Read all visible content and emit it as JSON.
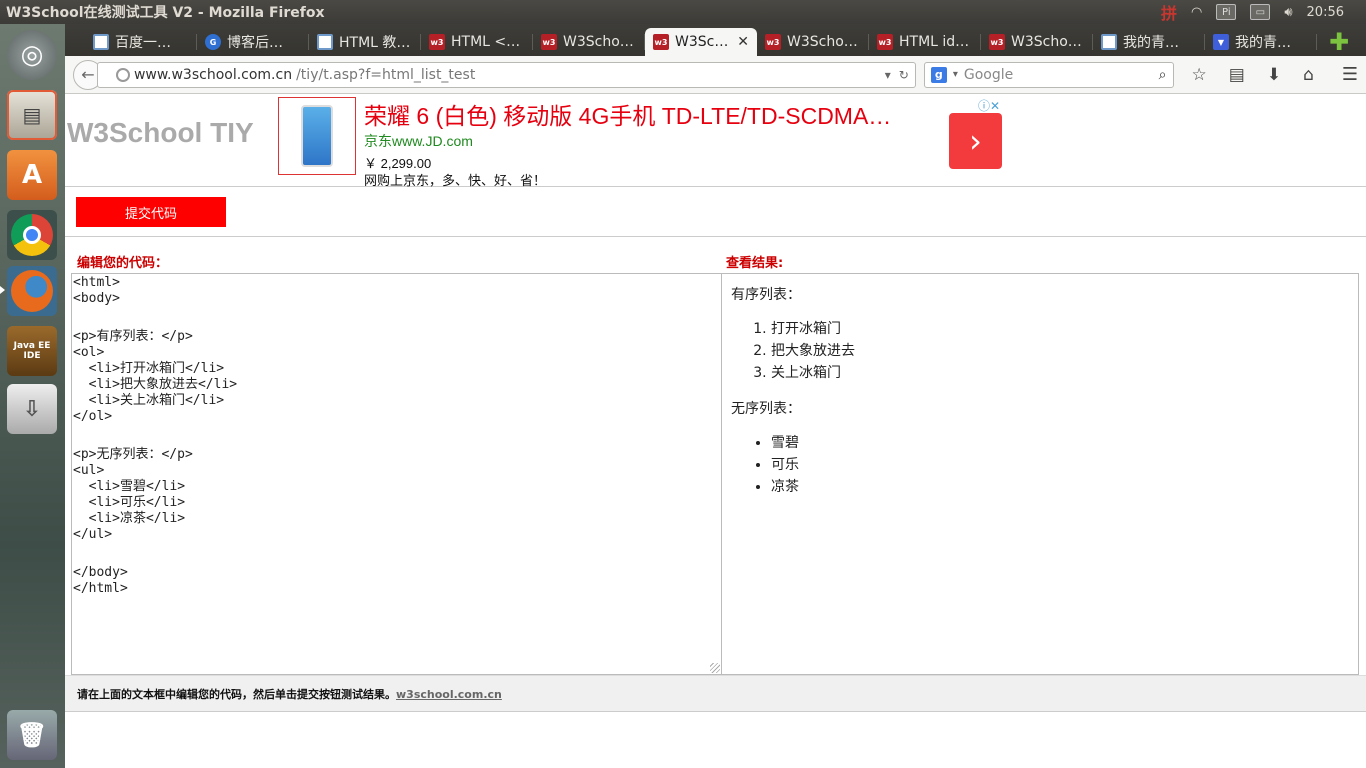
{
  "window": {
    "title": "W3School在线测试工具 V2 - Mozilla Firefox"
  },
  "tray": {
    "ime": "拼",
    "keyboard": "Pi",
    "clock": "20:56"
  },
  "tabs": [
    {
      "label": "百度一…",
      "icon": "bookmark-icon"
    },
    {
      "label": "博客后…",
      "icon": "cnblogs-icon"
    },
    {
      "label": "HTML 教…",
      "icon": "bookmark-icon"
    },
    {
      "label": "HTML <…",
      "icon": "w3-icon"
    },
    {
      "label": "W3Scho…",
      "icon": "w3-icon"
    },
    {
      "label": "W3Sc…",
      "icon": "w3-icon",
      "active": true
    },
    {
      "label": "W3Scho…",
      "icon": "w3-icon"
    },
    {
      "label": "HTML id…",
      "icon": "w3-icon"
    },
    {
      "label": "W3Scho…",
      "icon": "w3-icon"
    },
    {
      "label": "我的青…",
      "icon": "bookmark-icon"
    },
    {
      "label": "我的青…",
      "icon": "baidu-icon"
    }
  ],
  "navbar": {
    "url_host": "www.w3school.com.cn",
    "url_path": "/tiy/t.asp?f=html_list_test",
    "search_placeholder": "Google"
  },
  "page": {
    "logo": "W3School TIY",
    "ad": {
      "title": "荣耀 6 (白色) 移动版 4G手机 TD-LTE/TD-SCDMA…",
      "url": "京东www.JD.com",
      "price": "￥ 2,299.00",
      "desc": "网购上京东，多、快、好、省！"
    },
    "submit_label": "提交代码",
    "editor_label": "编辑您的代码：",
    "result_label": "查看结果:",
    "code_lines": [
      "<html>",
      "<body>",
      "",
      "<p>有序列表：</p>",
      "<ol>",
      "  <li>打开冰箱门</li>",
      "  <li>把大象放进去</li>",
      "  <li>关上冰箱门</li>",
      "</ol>",
      "",
      "<p>无序列表：</p>",
      "<ul>",
      "  <li>雪碧</li>",
      "  <li>可乐</li>",
      "  <li>凉茶</li>",
      "</ul>",
      "",
      "</body>",
      "</html>"
    ],
    "result": {
      "ordered_heading": "有序列表：",
      "ordered_items": [
        "打开冰箱门",
        "把大象放进去",
        "关上冰箱门"
      ],
      "unordered_heading": "无序列表：",
      "unordered_items": [
        "雪碧",
        "可乐",
        "凉茶"
      ]
    },
    "footer_text": "请在上面的文本框中编辑您的代码，然后单击提交按钮测试结果。",
    "footer_link": "w3school.com.cn"
  }
}
